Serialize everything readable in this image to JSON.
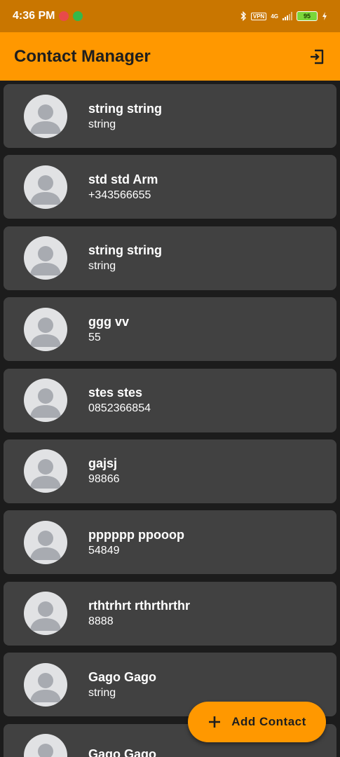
{
  "status_bar": {
    "time": "4:36 PM",
    "vpn": "VPN",
    "network": "4G",
    "battery": "95"
  },
  "app_bar": {
    "title": "Contact Manager",
    "logout_icon": "logout-icon"
  },
  "contacts": [
    {
      "name": "string string",
      "detail": "string"
    },
    {
      "name": "std std Arm",
      "detail": "+343566655"
    },
    {
      "name": "string string",
      "detail": "string"
    },
    {
      "name": "ggg vv",
      "detail": "55"
    },
    {
      "name": "stes stes",
      "detail": "0852366854"
    },
    {
      "name": "gajsj",
      "detail": "98866"
    },
    {
      "name": "pppppp ppooop",
      "detail": "54849"
    },
    {
      "name": "rthtrhrt rthrthrthr",
      "detail": "8888"
    },
    {
      "name": "Gago Gago",
      "detail": "string"
    },
    {
      "name": "Gago Gago",
      "detail": ""
    }
  ],
  "fab": {
    "label": "Add Contact",
    "icon": "plus-icon"
  },
  "colors": {
    "accent": "#ff9800",
    "status_bar": "#c97600",
    "background": "#1c1c1c",
    "card": "#414141"
  }
}
